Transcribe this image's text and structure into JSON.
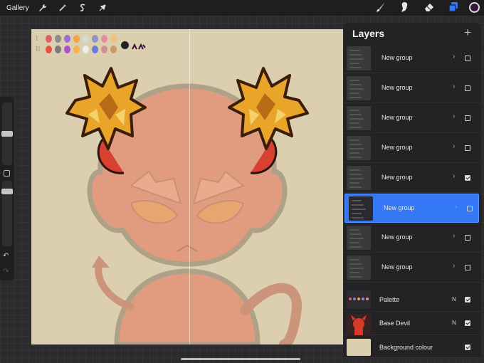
{
  "topbar": {
    "gallery_label": "Gallery",
    "left_icons": [
      "wrench-icon",
      "magic-wand-icon",
      "selection-s-icon",
      "transform-arrow-icon"
    ],
    "right_icons": [
      "brush-icon",
      "smudge-icon",
      "eraser-icon",
      "layers-icon"
    ],
    "current_color": "#3b1240",
    "accent": "#3478f6"
  },
  "canvas": {
    "background": "#dccfb0",
    "palette_rows": [
      {
        "roman": "I",
        "colors": [
          "#e0606a",
          "#8b8b8b",
          "#9a6fcf",
          "#f4a14a",
          "#d9d9d9",
          "#8e95c9",
          "#e38fa1",
          "#f1c27d"
        ]
      },
      {
        "roman": "II",
        "colors": [
          "#e85040",
          "#7a7a7a",
          "#b050d0",
          "#f7b24a",
          "#eeeeee",
          "#6a7ad6",
          "#cf9090",
          "#c8996a"
        ]
      }
    ]
  },
  "layers_panel": {
    "title": "Layers",
    "add_label": "+",
    "layers": [
      {
        "name": "New group",
        "type": "group",
        "checked": false,
        "selected": false
      },
      {
        "name": "New group",
        "type": "group",
        "checked": false,
        "selected": false
      },
      {
        "name": "New group",
        "type": "group",
        "checked": false,
        "selected": false
      },
      {
        "name": "New group",
        "type": "group",
        "checked": false,
        "selected": false
      },
      {
        "name": "New group",
        "type": "group",
        "checked": true,
        "selected": false
      },
      {
        "name": "New group",
        "type": "group",
        "checked": false,
        "selected": true
      },
      {
        "name": "New group",
        "type": "group",
        "checked": false,
        "selected": false
      },
      {
        "name": "New group",
        "type": "group",
        "checked": false,
        "selected": false
      },
      {
        "name": "Palette",
        "type": "layer",
        "blend": "N",
        "checked": true,
        "selected": false
      },
      {
        "name": "Base Devil",
        "type": "layer",
        "blend": "N",
        "checked": true,
        "selected": false
      },
      {
        "name": "Background colour",
        "type": "background",
        "checked": true,
        "selected": false
      }
    ]
  }
}
